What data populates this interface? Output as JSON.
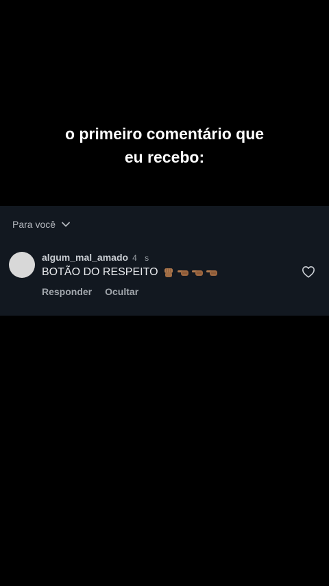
{
  "caption": {
    "line1": "o primeiro comentário que",
    "line2": "eu recebo:"
  },
  "comments": {
    "filter_label": "Para você",
    "items": [
      {
        "username": "algum_mal_amado",
        "time": "4 s",
        "text": "BOTÃO DO RESPEITO",
        "emojis": [
          "raised-fist-icon",
          "pointing-hand-icon",
          "pointing-hand-icon",
          "pointing-hand-icon"
        ],
        "reply_label": "Responder",
        "hide_label": "Ocultar"
      }
    ]
  },
  "colors": {
    "background": "#000000",
    "panel": "#121820",
    "avatar": "#d8d8d8",
    "emoji_skin": "#b07a4f"
  }
}
